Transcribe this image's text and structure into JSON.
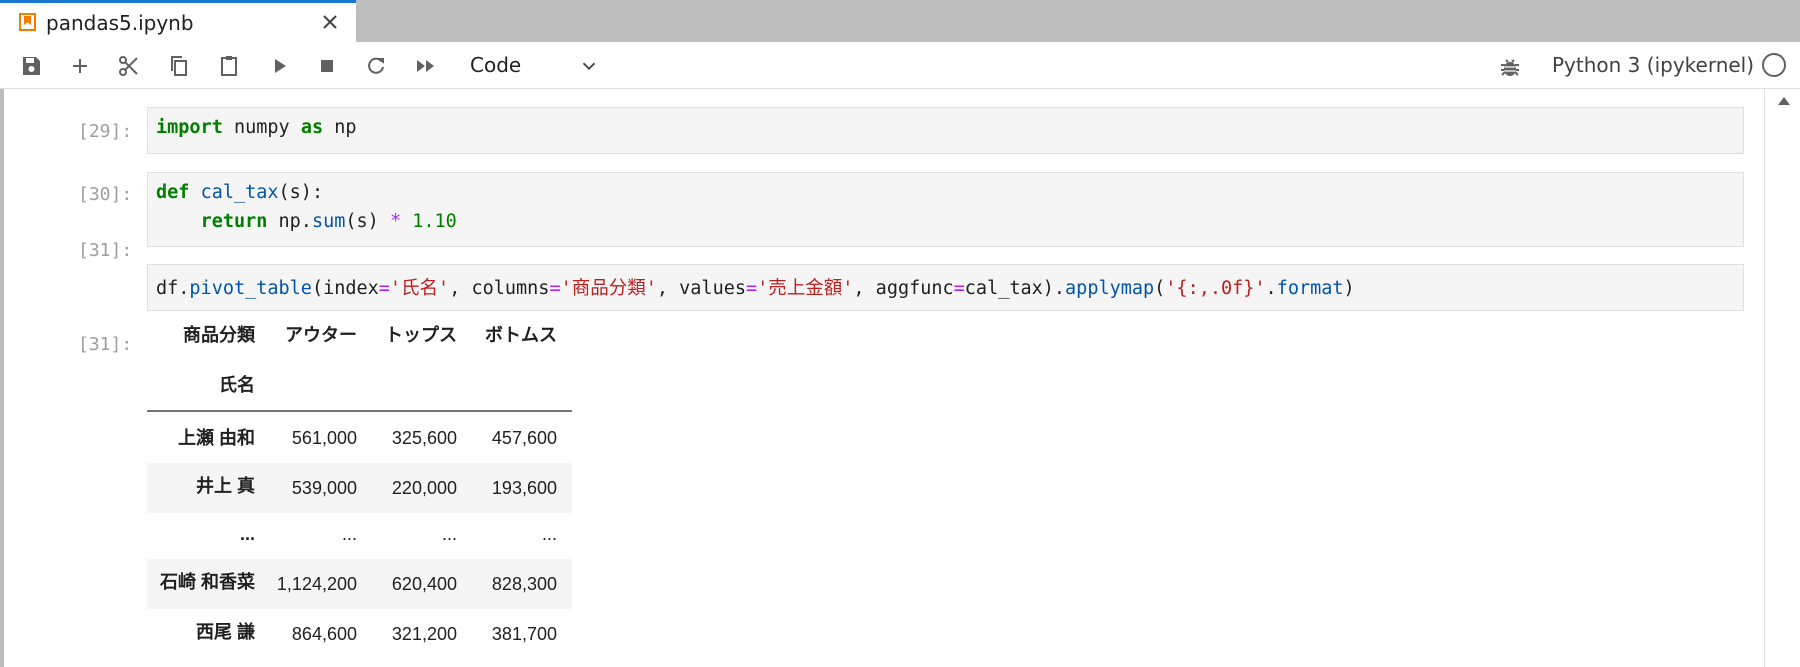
{
  "tab": {
    "title": "pandas5.ipynb",
    "icon": "notebook-icon",
    "close_icon": "close-icon"
  },
  "toolbar": {
    "buttons": [
      "save-icon",
      "plus-icon",
      "cut-icon",
      "copy-icon",
      "paste-icon",
      "run-icon",
      "stop-icon",
      "restart-icon",
      "fast-forward-icon"
    ],
    "cell_type": "Code",
    "kernel": "Python 3 (ipykernel)"
  },
  "cells": [
    {
      "prompt": "[29]:",
      "lines": [
        [
          [
            "kw",
            "import"
          ],
          [
            "",
            "numpy"
          ],
          [
            "kw",
            "as"
          ],
          [
            "",
            "np"
          ]
        ]
      ]
    },
    {
      "prompt": "[30]:",
      "lines": [
        [
          [
            "kw",
            "def"
          ],
          [
            "fn",
            "cal_tax"
          ],
          [
            "",
            "(s):"
          ]
        ],
        [
          [
            "",
            "    "
          ],
          [
            "kw",
            "return"
          ],
          [
            "",
            "np."
          ],
          [
            "fn",
            "sum"
          ],
          [
            "",
            "(s)"
          ],
          [
            "op",
            "*"
          ],
          [
            "num",
            "1.10"
          ]
        ]
      ]
    },
    {
      "prompt": "[31]:"
    }
  ],
  "cell31_code": {
    "p1": "df.",
    "p2": "pivot_table",
    "p3": "(index",
    "p4": "=",
    "p5": "'氏名'",
    "p6": ", columns",
    "p7": "=",
    "p8": "'商品分類'",
    "p9": ", values",
    "p10": "=",
    "p11": "'売上金額'",
    "p12": ", aggfunc",
    "p13": "=",
    "p14": "cal_tax).",
    "p15": "applymap",
    "p16": "(",
    "p17": "'{:,.0f}'",
    "p18": ".",
    "p19": "format",
    "p20": ")"
  },
  "output": {
    "prompt": "[31]:",
    "columns_name": "商品分類",
    "index_name": "氏名",
    "columns": [
      "アウター",
      "トップス",
      "ボトムス"
    ],
    "rows": [
      {
        "name": "上瀬 由和",
        "values": [
          "561,000",
          "325,600",
          "457,600"
        ]
      },
      {
        "name": "井上 真",
        "values": [
          "539,000",
          "220,000",
          "193,600"
        ]
      },
      {
        "name": "...",
        "values": [
          "...",
          "...",
          "..."
        ]
      },
      {
        "name": "石崎 和香菜",
        "values": [
          "1,124,200",
          "620,400",
          "828,300"
        ]
      },
      {
        "name": "西尾 謙",
        "values": [
          "864,600",
          "321,200",
          "381,700"
        ]
      }
    ]
  }
}
